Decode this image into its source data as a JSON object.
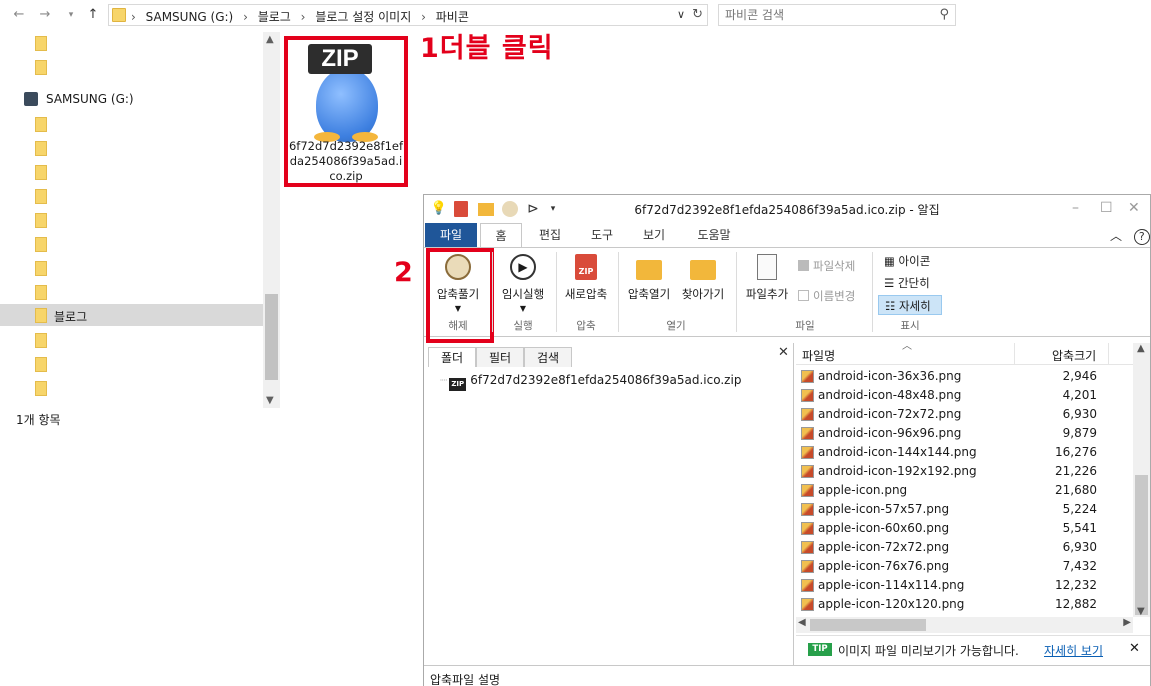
{
  "explorer": {
    "address": {
      "crumbs": [
        "SAMSUNG (G:)",
        "블로그",
        "블로그 설정 이미지",
        "파비콘"
      ],
      "search_placeholder": "파비콘 검색"
    },
    "nav": {
      "drive_label": "SAMSUNG (G:)",
      "selected_folder": "블로그"
    },
    "status": "1개 항목",
    "file": {
      "badge": "ZIP",
      "name": "6f72d7d2392e8f1efda254086f39a5ad.ico.zip"
    }
  },
  "annotations": {
    "step1": "1더블 클릭",
    "step2": "2"
  },
  "alzip": {
    "title": "6f72d7d2392e8f1efda254086f39a5ad.ico.zip - 알집",
    "tabs": [
      "파일",
      "홈",
      "편집",
      "도구",
      "보기",
      "도움말"
    ],
    "ribbon": {
      "extract": {
        "label": "압축풀기",
        "group": "해제"
      },
      "run": {
        "label": "임시실행",
        "group": "실행"
      },
      "new_archive": {
        "label": "새로압축",
        "group": "압축"
      },
      "open_archive": "압축열기",
      "find": "찾아가기",
      "open_group": "열기",
      "add_file": "파일추가",
      "delete_file": "파일삭제",
      "rename": "이름변경",
      "file_group": "파일",
      "view_icon": "아이콘",
      "view_simple": "간단히",
      "view_detail": "자세히",
      "view_group": "표시"
    },
    "left_pane": {
      "tabs": [
        "폴더",
        "필터",
        "검색"
      ],
      "archive": "6f72d7d2392e8f1efda254086f39a5ad.ico.zip"
    },
    "file_list": {
      "col_name": "파일명",
      "col_size": "압축크기",
      "rows": [
        {
          "name": "android-icon-36x36.png",
          "size": "2,946"
        },
        {
          "name": "android-icon-48x48.png",
          "size": "4,201"
        },
        {
          "name": "android-icon-72x72.png",
          "size": "6,930"
        },
        {
          "name": "android-icon-96x96.png",
          "size": "9,879"
        },
        {
          "name": "android-icon-144x144.png",
          "size": "16,276"
        },
        {
          "name": "android-icon-192x192.png",
          "size": "21,226"
        },
        {
          "name": "apple-icon.png",
          "size": "21,680"
        },
        {
          "name": "apple-icon-57x57.png",
          "size": "5,224"
        },
        {
          "name": "apple-icon-60x60.png",
          "size": "5,541"
        },
        {
          "name": "apple-icon-72x72.png",
          "size": "6,930"
        },
        {
          "name": "apple-icon-76x76.png",
          "size": "7,432"
        },
        {
          "name": "apple-icon-114x114.png",
          "size": "12,232"
        },
        {
          "name": "apple-icon-120x120.png",
          "size": "12,882"
        }
      ]
    },
    "tip": {
      "badge": "TIP",
      "text": "이미지 파일 미리보기가 가능합니다.",
      "link": "자세히 보기"
    },
    "bottom_label": "압축파일 설명"
  }
}
